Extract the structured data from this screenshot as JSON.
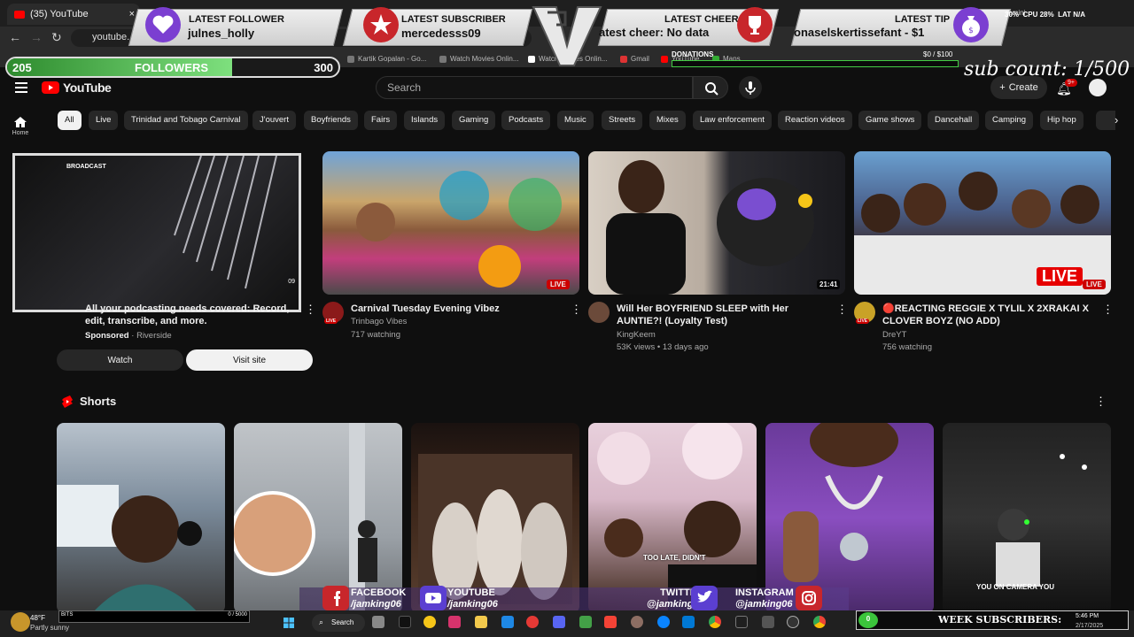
{
  "browser": {
    "tab_title": "(35) YouTube",
    "url": "youtube.",
    "profile": "Gemini",
    "bookmarks": [
      "Kartik Gopalan - Go...",
      "Watch Movies Onlin...",
      "Watch Movies Onlin...",
      "Gmail",
      "YouTube",
      "Maps"
    ]
  },
  "overlay": {
    "latest_follower": {
      "label": "LATEST FOLLOWER",
      "value": "julnes_holly"
    },
    "latest_subscriber": {
      "label": "LATEST SUBSCRIBER",
      "value": "mercedesss09"
    },
    "latest_cheer": {
      "label": "LATEST CHEER",
      "value": "atest cheer: No data"
    },
    "latest_tip": {
      "label": "LATEST TIP",
      "value": "onaselskertissefant - $1"
    },
    "followers_goal": {
      "current": "205",
      "label": "FOLLOWERS",
      "target": "300",
      "progress": 0.68
    },
    "donations": {
      "label": "DONATIONS",
      "amount": "$0",
      "goal": "/ $100",
      "progress": 0.0
    },
    "sub_count": "sub count: 1/500",
    "stats": {
      "cpu_label": "CPU",
      "cpu": "28%",
      "lat_label": "LAT",
      "lat": "N/A",
      "pct": "30%"
    },
    "broadcast_label": "BROADCAST",
    "week_subscribers": {
      "label": "WEEK SUBSCRIBERS:",
      "count": "0"
    },
    "bits": {
      "label": "BITS",
      "value": "0 / 5000"
    },
    "socials": [
      {
        "name": "FACEBOOK",
        "handle": "/jamking06"
      },
      {
        "name": "YOUTUBE",
        "handle": "/jamking06"
      },
      {
        "name": "TWITTER",
        "handle": "@jamking06"
      },
      {
        "name": "INSTAGRAM",
        "handle": "@jamking06"
      }
    ]
  },
  "youtube": {
    "logo": "YouTube",
    "search_placeholder": "Search",
    "create_label": "Create",
    "notif_count": "9+",
    "side": {
      "home": "Home"
    },
    "chips": [
      "All",
      "Live",
      "Trinidad and Tobago Carnival",
      "J'ouvert",
      "Boyfriends",
      "Fairs",
      "Islands",
      "Gaming",
      "Podcasts",
      "Music",
      "Streets",
      "Mixes",
      "Law enforcement",
      "Reaction videos",
      "Game shows",
      "Dancehall",
      "Camping",
      "Hip hop"
    ],
    "ad": {
      "title": "All your podcasting needs covered: Record, edit, transcribe, and more.",
      "sponsored": "Sponsored",
      "advertiser": "Riverside",
      "watch": "Watch",
      "visit": "Visit site",
      "duration": "09"
    },
    "videos": [
      {
        "title": "Carnival Tuesday Evening Vibez",
        "channel": "Trinbago Vibes",
        "meta": "717 watching",
        "badge": "LIVE"
      },
      {
        "title": "Will Her BOYFRIEND SLEEP with Her AUNTIE?! (Loyalty Test)",
        "channel": "KingKeem",
        "meta": "53K views • 13 days ago",
        "duration": "21:41"
      },
      {
        "title": "🔴REACTING REGGIE X TYLIL X 2XRAKAI X CLOVER BOYZ (NO ADD)",
        "channel": "DreYT",
        "meta": "756 watching",
        "badge": "LIVE",
        "thumb_live": "LIVE"
      }
    ],
    "shorts_title": "Shorts",
    "shorts_captions": [
      "",
      "",
      "",
      "TOO LATE, DIDN'T",
      "",
      "YOU ON CAMERA YOU"
    ]
  },
  "taskbar": {
    "weather_temp": "48°F",
    "weather_desc": "Partly sunny",
    "search": "Search",
    "time": "5:46 PM",
    "date": "2/17/2025"
  }
}
